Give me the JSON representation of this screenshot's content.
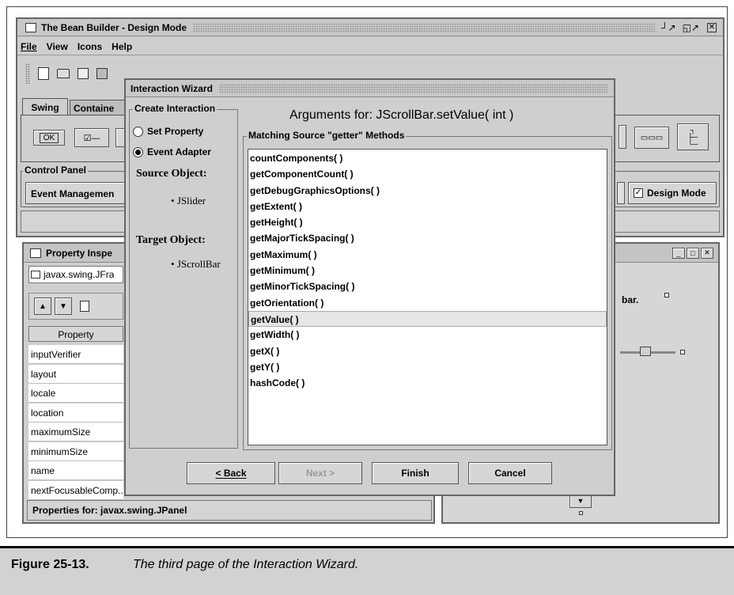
{
  "bean_builder": {
    "title": "The Bean Builder - Design Mode",
    "window_controls": [
      "↘↗",
      "↗",
      "☒"
    ],
    "menu": [
      "File",
      "View",
      "Icons",
      "Help"
    ],
    "palette_tabs": [
      "Swing",
      "Containe"
    ],
    "palette_ok": "OK",
    "control_panel_label": "Control Panel",
    "event_management": "Event Managemen",
    "design_mode_label": "Design Mode",
    "design_mode_checked": true
  },
  "property_inspector": {
    "title": "Property Inspe",
    "object_field": "javax.swing.JFra",
    "column_header": "Property",
    "rows": [
      "inputVerifier",
      "layout",
      "locale",
      "location",
      "maximumSize",
      "minimumSize",
      "name",
      "nextFocusableComp..."
    ],
    "footer": "Properties for:  javax.swing.JPanel"
  },
  "test_frame": {
    "label": "bar.",
    "slider_value_fraction": 0.45
  },
  "wizard": {
    "title": "Interaction Wizard",
    "create_group": "Create Interaction",
    "options": [
      {
        "label": "Set Property",
        "selected": false
      },
      {
        "label": "Event Adapter",
        "selected": true
      }
    ],
    "source_label": "Source Object:",
    "source_value": "JSlider",
    "target_label": "Target Object:",
    "target_value": "JScrollBar",
    "heading": "Arguments for: JScrollBar.setValue( int )",
    "methods_group": "Matching Source \"getter\" Methods",
    "methods": [
      "countComponents( )",
      "getComponentCount( )",
      "getDebugGraphicsOptions( )",
      "getExtent( )",
      "getHeight( )",
      "getMajorTickSpacing( )",
      "getMaximum( )",
      "getMinimum( )",
      "getMinorTickSpacing( )",
      "getOrientation( )",
      "getValue( )",
      "getWidth( )",
      "getX( )",
      "getY( )",
      "hashCode( )"
    ],
    "selected_method": "getValue( )",
    "buttons": {
      "back": "< Back",
      "next": "Next >",
      "finish": "Finish",
      "cancel": "Cancel"
    }
  },
  "caption": {
    "figure": "Figure 25-13.",
    "text": "The third page of the Interaction Wizard."
  }
}
